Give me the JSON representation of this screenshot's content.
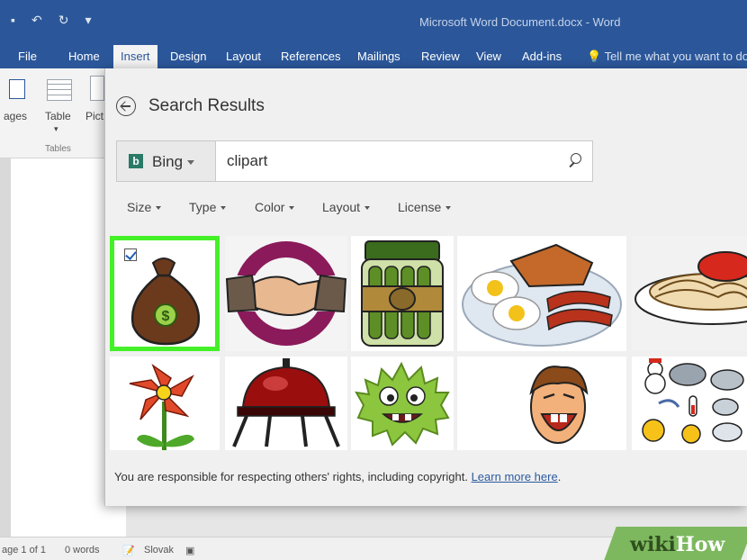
{
  "titlebar": {
    "doc_title": "Microsoft Word Document.docx  -  Word"
  },
  "tabs": [
    "File",
    "Home",
    "Insert",
    "Design",
    "Layout",
    "References",
    "Mailings",
    "Review",
    "View",
    "Add-ins"
  ],
  "tell_me": "Tell me what you want to do",
  "ribbon": {
    "pages_label": "ages",
    "table_label": "Table",
    "pictures_label": "Pict",
    "group_tables": "Tables"
  },
  "dialog": {
    "title": "Search Results",
    "search": {
      "provider": "Bing",
      "query": "clipart"
    },
    "filters": [
      "Size",
      "Type",
      "Color",
      "Layout",
      "License"
    ],
    "results": [
      {
        "name": "money-bag",
        "selected": true
      },
      {
        "name": "handshake",
        "selected": false
      },
      {
        "name": "pickle-jar",
        "selected": false
      },
      {
        "name": "breakfast",
        "selected": false
      },
      {
        "name": "spaghetti",
        "selected": false
      },
      {
        "name": "flower",
        "selected": false
      },
      {
        "name": "grill",
        "selected": false
      },
      {
        "name": "green-monster",
        "selected": false
      },
      {
        "name": "laughing-face",
        "selected": false
      },
      {
        "name": "weather-icons",
        "selected": false
      }
    ],
    "footer_text": "You are responsible for respecting others' rights, including copyright.",
    "footer_link": "Learn more here",
    "footer_end": "."
  },
  "statusbar": {
    "page": "age 1 of 1",
    "words": "0 words",
    "language": "Slovak"
  },
  "watermark": {
    "part1": "wiki",
    "part2": "How"
  },
  "colors": {
    "word_blue": "#2b579a",
    "selection_green": "#44f028",
    "bing_teal": "#2a7a68",
    "link_blue": "#2b5aa0"
  }
}
